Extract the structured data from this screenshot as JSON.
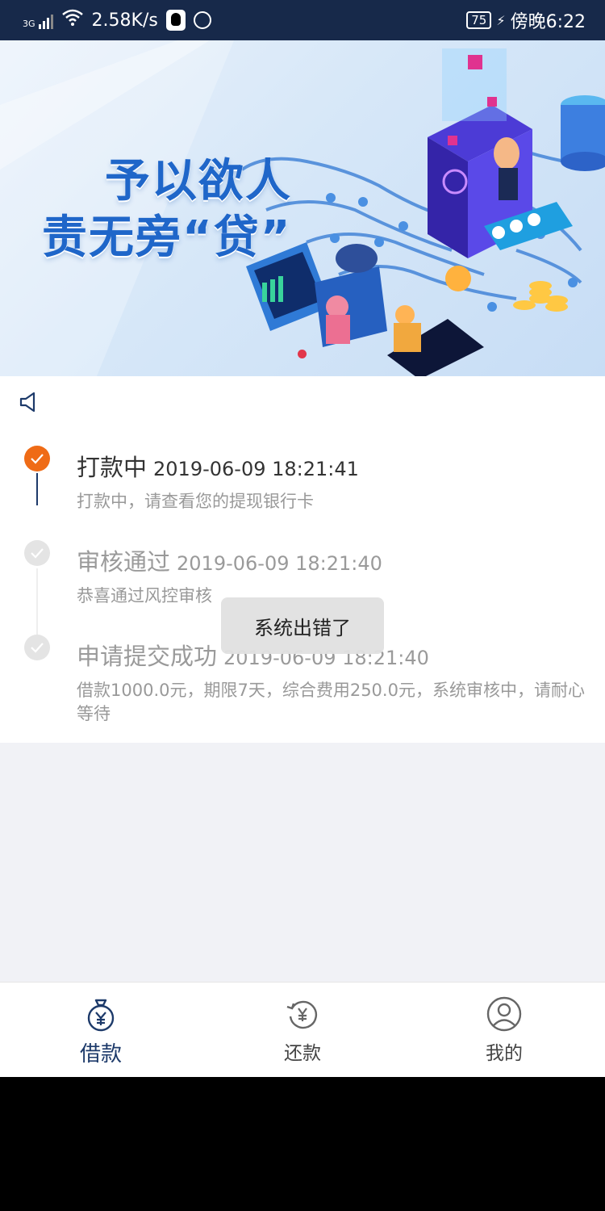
{
  "status_bar": {
    "network": "3G",
    "speed": "2.58K/s",
    "battery": "75",
    "time": "傍晚6:22"
  },
  "banner": {
    "line1": "予以欲人",
    "line2": "责无旁“贷”",
    "dots_count": 1,
    "active_dot": 0
  },
  "timeline": [
    {
      "title": "打款中",
      "date": "2019-06-09 18:21:41",
      "desc": "打款中，请查看您的提现银行卡",
      "status": "active"
    },
    {
      "title": "审核通过",
      "date": "2019-06-09 18:21:40",
      "desc": "恭喜通过风控审核",
      "status": "done"
    },
    {
      "title": "申请提交成功",
      "date": "2019-06-09 18:21:40",
      "desc": "借款1000.0元，期限7天，综合费用250.0元，系统审核中，请耐心等待",
      "status": "done"
    }
  ],
  "toast": "系统出错了",
  "bottom_nav": [
    {
      "label": "借款",
      "icon": "money-bag-icon",
      "active": true
    },
    {
      "label": "还款",
      "icon": "repay-icon",
      "active": false
    },
    {
      "label": "我的",
      "icon": "profile-icon",
      "active": false
    }
  ],
  "colors": {
    "status_bar": "#17294a",
    "active_step": "#ef6b16",
    "nav_active": "#1d3a6a"
  }
}
